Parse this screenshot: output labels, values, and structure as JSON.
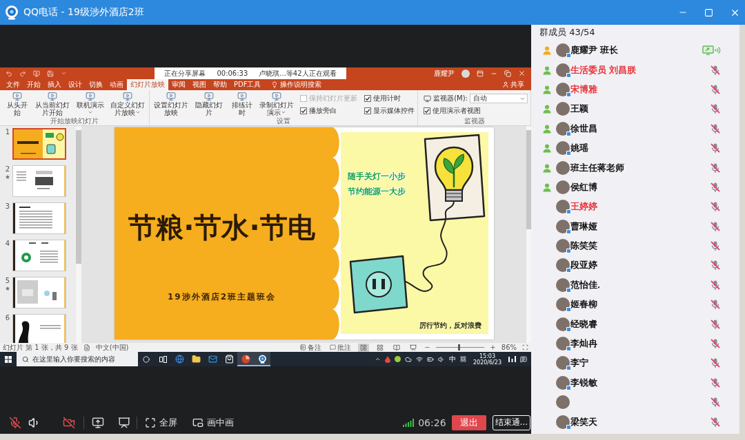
{
  "window": {
    "title": "QQ电话 - 19级涉外酒店2班"
  },
  "shared_screen": {
    "share_banner": {
      "status": "正在分享屏幕",
      "elapsed": "00:06:33",
      "viewers": "卢晓琪...等42人正在观看"
    },
    "ppt": {
      "user": "鹿耀尹",
      "tabs": [
        {
          "label": "文件",
          "selected": false
        },
        {
          "label": "开始",
          "selected": false
        },
        {
          "label": "插入",
          "selected": false
        },
        {
          "label": "设计",
          "selected": false
        },
        {
          "label": "切换",
          "selected": false
        },
        {
          "label": "动画",
          "selected": false
        },
        {
          "label": "幻灯片放映",
          "selected": true
        },
        {
          "label": "审阅",
          "selected": false
        },
        {
          "label": "视图",
          "selected": false
        },
        {
          "label": "帮助",
          "selected": false
        },
        {
          "label": "PDF工具",
          "selected": false
        }
      ],
      "search_hint": "操作说明搜索",
      "share": "共享",
      "ribbon_groups": [
        {
          "label": "开始放映幻灯片",
          "items": [
            {
              "kind": "button",
              "label": "从头开始"
            },
            {
              "kind": "button",
              "label": "从当前幻灯片开始"
            },
            {
              "kind": "menu_button",
              "label": "联机演示"
            },
            {
              "kind": "menu_button",
              "label": "自定义幻灯片放映"
            }
          ]
        },
        {
          "label": "设置",
          "items": [
            {
              "kind": "button",
              "label": "设置幻灯片放映"
            },
            {
              "kind": "button",
              "label": "隐藏幻灯片"
            },
            {
              "kind": "button",
              "label": "排练计时"
            },
            {
              "kind": "menu_button",
              "label": "录制幻灯片演示"
            },
            {
              "kind": "check",
              "label": "保持幻灯片更新",
              "checked": false,
              "disabled": true
            },
            {
              "kind": "check",
              "label": "播放旁白",
              "checked": true,
              "disabled": false
            },
            {
              "kind": "check",
              "label": "使用计时",
              "checked": true,
              "disabled": false
            },
            {
              "kind": "check",
              "label": "显示媒体控件",
              "checked": true,
              "disabled": false
            }
          ]
        },
        {
          "label": "监视器",
          "items": [
            {
              "kind": "select",
              "label": "监视器(M):",
              "value": "自动"
            },
            {
              "kind": "check",
              "label": "使用演示者视图",
              "checked": true,
              "disabled": false
            }
          ]
        }
      ],
      "thumbnails": [
        {
          "number": "1",
          "kind": "title",
          "selected": true,
          "animated": false
        },
        {
          "number": "2",
          "kind": "figures",
          "selected": false,
          "animated": true
        },
        {
          "number": "3",
          "kind": "list",
          "selected": false,
          "animated": false
        },
        {
          "number": "4",
          "kind": "logo",
          "selected": false,
          "animated": false
        },
        {
          "number": "5",
          "kind": "photo",
          "selected": false,
          "animated": true
        },
        {
          "number": "6",
          "kind": "figure",
          "selected": false,
          "animated": false
        }
      ],
      "slide": {
        "title": "节粮·节水·节电",
        "subtitle": "19涉外酒店2班主题班会",
        "slogan": [
          "随手关灯一小步",
          "节约能源一大步"
        ],
        "caption": "厉行节约，反对浪费"
      },
      "status_bar": {
        "slide_info": "幻灯片 第 1 张，共 9 张",
        "language": "中文(中国)",
        "notes": "备注",
        "comments": "批注",
        "views": [
          {
            "kind": "normal",
            "selected": true
          },
          {
            "kind": "sorter",
            "selected": false
          },
          {
            "kind": "reading",
            "selected": false
          },
          {
            "kind": "show",
            "selected": false
          }
        ],
        "zoom": {
          "level": 0.47,
          "reading": "86%"
        }
      }
    },
    "taskbar": {
      "search_placeholder": "在这里输入你要搜索的内容",
      "apps": [
        {
          "kind": "browser",
          "running": false
        },
        {
          "kind": "folder",
          "running": false
        },
        {
          "kind": "mail",
          "running": false
        },
        {
          "kind": "store",
          "running": false
        },
        {
          "kind": "slides",
          "running": true
        },
        {
          "kind": "call",
          "running": true
        }
      ],
      "ime": "中",
      "time": "15:03",
      "date": "2020/6/23"
    }
  },
  "call_toolbar": {
    "mic_muted": true,
    "camera_off": true,
    "fullscreen": "全屏",
    "picture_in_picture": "画中画",
    "duration": "06:26",
    "leave": "退出",
    "end": "结束通..."
  },
  "members": {
    "title": "群成员 43/54",
    "items": [
      {
        "name": "鹿耀尹 班长",
        "color": "#000000",
        "host": true,
        "admin": false,
        "badge": true,
        "sharing": true,
        "muted": false
      },
      {
        "name": "生活委员 刘昌朕",
        "color": "#e8262d",
        "host": false,
        "admin": true,
        "badge": true,
        "sharing": false,
        "muted": true
      },
      {
        "name": "宋博雅",
        "color": "#e8262d",
        "host": false,
        "admin": true,
        "badge": true,
        "sharing": false,
        "muted": true
      },
      {
        "name": "王颖",
        "color": "#000000",
        "host": false,
        "admin": true,
        "badge": false,
        "sharing": false,
        "muted": true
      },
      {
        "name": "徐世昌",
        "color": "#000000",
        "host": false,
        "admin": true,
        "badge": true,
        "sharing": false,
        "muted": true
      },
      {
        "name": "姚瑶",
        "color": "#000000",
        "host": false,
        "admin": true,
        "badge": true,
        "sharing": false,
        "muted": true
      },
      {
        "name": "班主任蒋老师",
        "color": "#000000",
        "host": false,
        "admin": true,
        "badge": false,
        "sharing": false,
        "muted": true
      },
      {
        "name": "侯红博",
        "color": "#000000",
        "host": false,
        "admin": true,
        "badge": false,
        "sharing": false,
        "muted": true
      },
      {
        "name": "王婷婷",
        "color": "#e8262d",
        "host": false,
        "admin": false,
        "badge": true,
        "sharing": false,
        "muted": true
      },
      {
        "name": "曹琳娅",
        "color": "#000000",
        "host": false,
        "admin": false,
        "badge": true,
        "sharing": false,
        "muted": true
      },
      {
        "name": "陈笑笑",
        "color": "#000000",
        "host": false,
        "admin": false,
        "badge": true,
        "sharing": false,
        "muted": true
      },
      {
        "name": "段亚婷",
        "color": "#000000",
        "host": false,
        "admin": false,
        "badge": true,
        "sharing": false,
        "muted": true
      },
      {
        "name": "范怡佳.",
        "color": "#000000",
        "host": false,
        "admin": false,
        "badge": true,
        "sharing": false,
        "muted": true
      },
      {
        "name": "姬春柳",
        "color": "#000000",
        "host": false,
        "admin": false,
        "badge": true,
        "sharing": false,
        "muted": true
      },
      {
        "name": "经晓睿",
        "color": "#000000",
        "host": false,
        "admin": false,
        "badge": true,
        "sharing": false,
        "muted": true
      },
      {
        "name": "李灿冉",
        "color": "#000000",
        "host": false,
        "admin": false,
        "badge": true,
        "sharing": false,
        "muted": true
      },
      {
        "name": "李宁",
        "color": "#000000",
        "host": false,
        "admin": false,
        "badge": true,
        "sharing": false,
        "muted": true
      },
      {
        "name": "李锐敏",
        "color": "#000000",
        "host": false,
        "admin": false,
        "badge": true,
        "sharing": false,
        "muted": true
      },
      {
        "host": false,
        "admin": false,
        "badge": false,
        "sharing": false,
        "muted": true
      },
      {
        "name": "梁笑天",
        "color": "#000000",
        "host": false,
        "admin": false,
        "badge": true,
        "sharing": false,
        "muted": true
      }
    ]
  }
}
